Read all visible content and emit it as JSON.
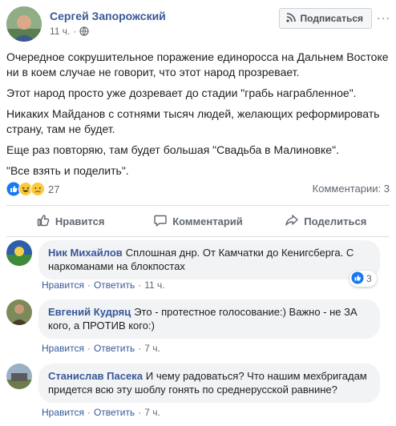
{
  "post": {
    "author": "Сергей Запорожский",
    "time": "11 ч.",
    "subscribe_label": "Подписаться",
    "paragraphs": [
      "Очередное сокрушительное поражение единоросса на Дальнем Востоке ни в коем случае не говорит, что этот народ прозревает.",
      "Этот народ просто уже дозревает до стадии \"грабь награбленное\".",
      "Никаких Майданов с сотнями тысяч людей, желающих реформировать страну, там не будет.",
      "Еще раз повторяю, там будет большая \"Свадьба в Малиновке\".",
      "\"Все взять и поделить\"."
    ],
    "reaction_count": "27",
    "comments_count": "Комментарии: 3"
  },
  "actions": {
    "like": "Нравится",
    "comment": "Комментарий",
    "share": "Поделиться"
  },
  "comments": [
    {
      "name": "Ник Михайлов",
      "text": "Сплошная днр. От Камчатки до Кенигсберга. С наркоманами на блокпостах",
      "like": "Нравится",
      "reply": "Ответить",
      "time": "11 ч.",
      "likes": "3"
    },
    {
      "name": "Евгений Кудряц",
      "text": "Это - протестное голосование:) Важно - не ЗА кого, а ПРОТИВ кого:)",
      "like": "Нравится",
      "reply": "Ответить",
      "time": "7 ч."
    },
    {
      "name": "Станислав Пасека",
      "text": "И чему радоваться? Что нашим мехбригадам придется всю эту шоблу гонять по среднерусской равнине?",
      "like": "Нравится",
      "reply": "Ответить",
      "time": "7 ч."
    }
  ],
  "colors": {
    "link": "#385898",
    "secondary": "#606770",
    "bubble": "#f2f3f5",
    "like_blue": "#1877f2"
  }
}
